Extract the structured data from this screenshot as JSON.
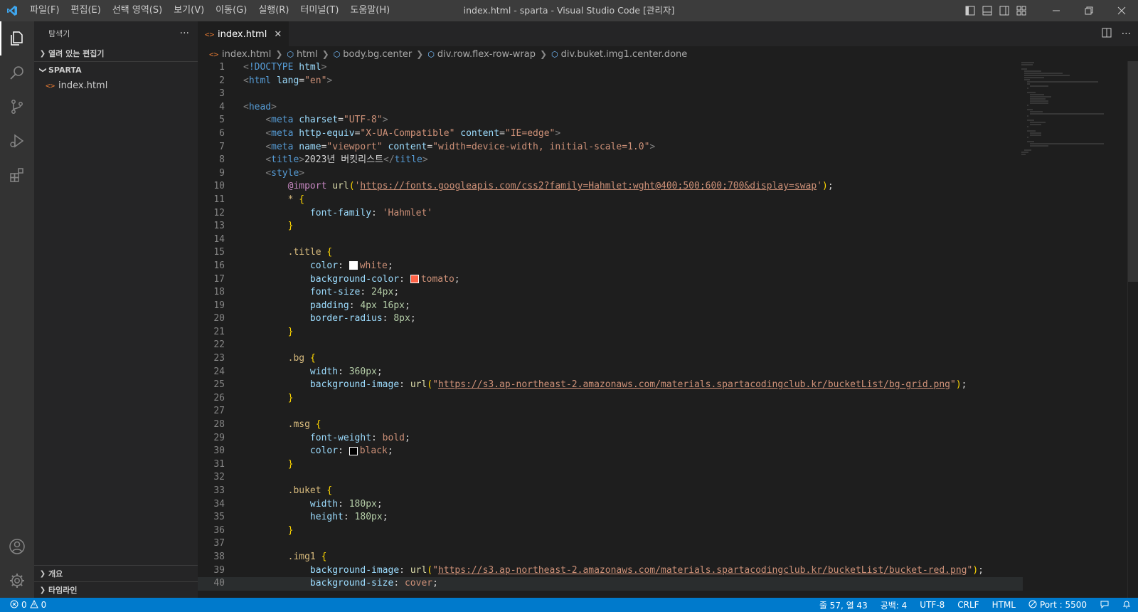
{
  "titlebar": {
    "menu": [
      "파일(F)",
      "편집(E)",
      "선택 영역(S)",
      "보기(V)",
      "이동(G)",
      "실행(R)",
      "터미널(T)",
      "도움말(H)"
    ],
    "window_title": "index.html - sparta - Visual Studio Code [관리자]"
  },
  "sidebar": {
    "title": "탐색기",
    "more": "···",
    "open_editors": "열려 있는 편집기",
    "folder": "SPARTA",
    "files": [
      "index.html"
    ],
    "outline": "개요",
    "timeline": "타임라인"
  },
  "editor": {
    "tab_label": "index.html",
    "tab_close": "✕",
    "breadcrumbs": [
      "index.html",
      "html",
      "body.bg.center",
      "div.row.flex-row-wrap",
      "div.buket.img1.center.done"
    ]
  },
  "code": {
    "doctype": "!DOCTYPE",
    "html": "html",
    "lang_attr": "lang",
    "lang_val": "\"en\"",
    "head": "head",
    "meta": "meta",
    "charset_attr": "charset",
    "charset_val": "\"UTF-8\"",
    "http_equiv_attr": "http-equiv",
    "http_equiv_val": "\"X-UA-Compatible\"",
    "content_attr": "content",
    "content_val_ie": "\"IE=edge\"",
    "name_attr": "name",
    "name_val": "\"viewport\"",
    "content_val_vp": "\"width=device-width, initial-scale=1.0\"",
    "title_tag": "title",
    "title_text": "2023년 버킷리스트",
    "style_tag": "style",
    "import": "@import",
    "url_fn": "url",
    "font_url": "https://fonts.googleapis.com/css2?family=Hahmlet:wght@400;500;600;700&display=swap",
    "star": "*",
    "font_family": "font-family",
    "hahmlet": "'Hahmlet'",
    "sel_title": ".title",
    "color": "color",
    "white": "white",
    "background_color": "background-color",
    "tomato": "tomato",
    "font_size": "font-size",
    "v24px": "24px",
    "padding": "padding",
    "v4px": "4px",
    "v16px": "16px",
    "border_radius": "border-radius",
    "v8px": "8px",
    "sel_bg": ".bg",
    "width": "width",
    "v360px": "360px",
    "background_image": "background-image",
    "bg_url": "https://s3.ap-northeast-2.amazonaws.com/materials.spartacodingclub.kr/bucketList/bg-grid.png",
    "sel_msg": ".msg",
    "font_weight": "font-weight",
    "bold": "bold",
    "black": "black",
    "sel_buket": ".buket",
    "height": "height",
    "v180px": "180px",
    "sel_img1": ".img1",
    "red_url": "https://s3.ap-northeast-2.amazonaws.com/materials.spartacodingclub.kr/bucketList/bucket-red.png",
    "background_size": "background-size",
    "cover": "cover"
  },
  "colors": {
    "white_swatch": "#ffffff",
    "tomato_swatch": "#ff6347",
    "black_swatch": "#000000",
    "statusbar": "#007acc",
    "accent": "#0e639c"
  },
  "statusbar": {
    "errors": "0",
    "warnings": "0",
    "position": "줄 57, 열 43",
    "spaces": "공백: 4",
    "encoding": "UTF-8",
    "eol": "CRLF",
    "language": "HTML",
    "port": "Port : 5500"
  },
  "icons": {
    "activity": [
      "explorer-icon",
      "search-icon",
      "source-control-icon",
      "run-debug-icon",
      "extensions-icon",
      "account-icon",
      "settings-gear-icon"
    ]
  }
}
